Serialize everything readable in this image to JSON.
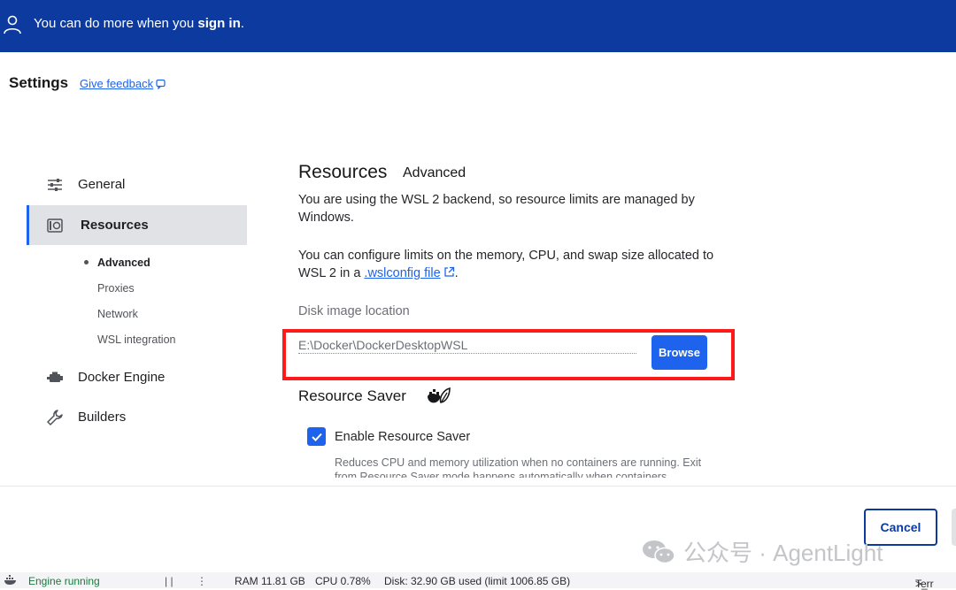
{
  "topbar": {
    "message_prefix": "You can do more when you",
    "sign_in": "sign in",
    "message_suffix": "."
  },
  "header": {
    "title": "Settings",
    "feedback_link": "Give feedback"
  },
  "sidebar": {
    "items": [
      {
        "label": "General",
        "icon": "sliders-icon"
      },
      {
        "label": "Resources",
        "icon": "resources-icon",
        "active": true
      },
      {
        "label": "Docker Engine",
        "icon": "engine-icon"
      },
      {
        "label": "Builders",
        "icon": "wrench-icon"
      }
    ],
    "sub_items": [
      "Advanced",
      "Proxies",
      "Network",
      "WSL integration"
    ]
  },
  "main": {
    "title": "Resources",
    "tab": "Advanced",
    "paragraph1": "You are using the WSL 2 backend, so resource limits are managed by Windows.",
    "paragraph2_prefix": "You can configure limits on the memory, CPU, and swap size allocated to WSL 2 in a",
    "wslconfig_link": ".wslconfig file",
    "paragraph2_suffix": ".",
    "disk_image_label": "Disk image location",
    "disk_image_value": "E:\\Docker\\DockerDesktopWSL",
    "browse_label": "Browse",
    "resource_saver_title": "Resource Saver",
    "enable_saver_label": "Enable Resource Saver",
    "enable_saver_checked": true,
    "saver_hint": "Reduces CPU and memory utilization when no containers are running. Exit from Resource Saver mode happens automatically when containers"
  },
  "footer": {
    "cancel_label": "Cancel",
    "watermark": "公众号 · AgentLight"
  },
  "statusbar": {
    "engine_status": "Engine running",
    "ram": "RAM 11.81 GB",
    "cpu": "CPU 0.78%",
    "disk": "Disk: 32.90 GB used (limit 1006.85 GB)",
    "terminal": "Terr"
  },
  "colors": {
    "brand": "#0c3a9e",
    "accent": "#1d63ed",
    "highlight": "#ff1a1a"
  }
}
